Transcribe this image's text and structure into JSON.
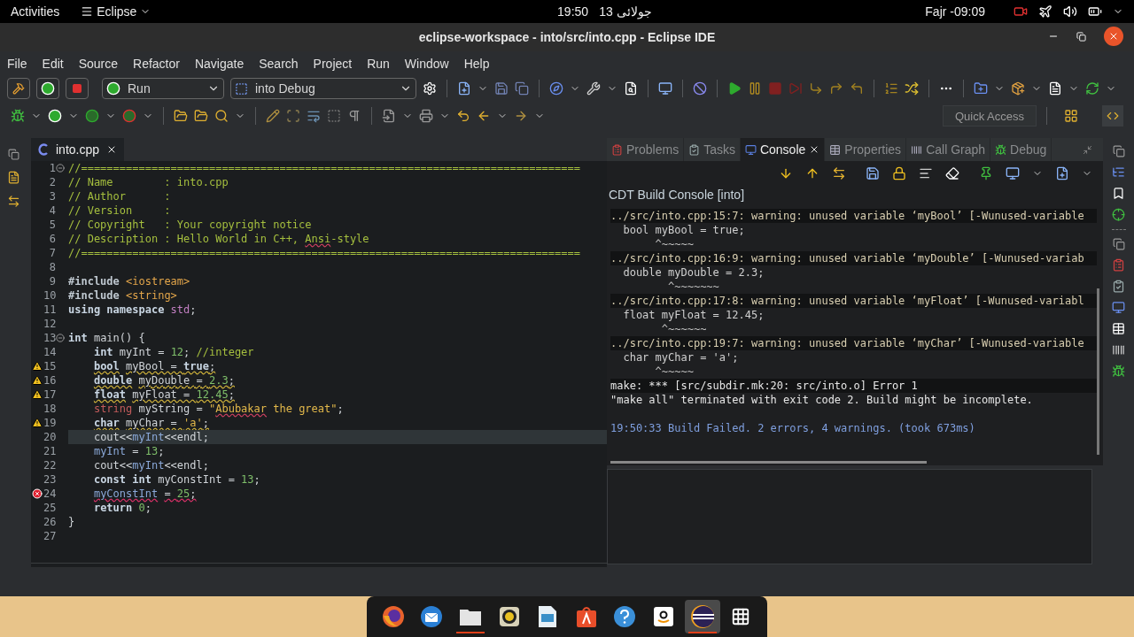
{
  "top_bar": {
    "activities": "Activities",
    "app_menu": "Eclipse",
    "time": "19:50",
    "date": "13 جولائی",
    "prayer": "Fajr -09:09"
  },
  "window": {
    "title": "eclipse-workspace - into/src/into.cpp - Eclipse IDE"
  },
  "menu": [
    "File",
    "Edit",
    "Source",
    "Refactor",
    "Navigate",
    "Search",
    "Project",
    "Run",
    "Window",
    "Help"
  ],
  "toolbar": {
    "run_mode": "Run",
    "launch_config": "into Debug",
    "quick_access": {
      "placeholder": "Quick Access"
    }
  },
  "editor": {
    "tabs": [
      {
        "label": "into.cpp",
        "selected": true
      }
    ],
    "lines": [
      {
        "number": "1",
        "marker": {
          "kind": "fold"
        },
        "highlighted": false,
        "tokens": [
          {
            "text": "//==============================================================================",
            "kind": "comment"
          }
        ]
      },
      {
        "number": "2",
        "highlighted": false,
        "tokens": [
          {
            "text": "// Name        : into.cpp",
            "kind": "comment"
          }
        ]
      },
      {
        "number": "3",
        "highlighted": false,
        "tokens": [
          {
            "text": "// Author      :",
            "kind": "comment"
          }
        ]
      },
      {
        "number": "4",
        "highlighted": false,
        "tokens": [
          {
            "text": "// Version     :",
            "kind": "comment"
          }
        ]
      },
      {
        "number": "5",
        "highlighted": false,
        "tokens": [
          {
            "text": "// Copyright   : Your copyright notice",
            "kind": "comment"
          }
        ]
      },
      {
        "number": "6",
        "highlighted": false,
        "tokens": [
          {
            "text": "// Description : Hello World in C++, ",
            "kind": "comment"
          },
          {
            "text": "Ansi",
            "kind": "comment",
            "squiggle": {
              "kind": "spelling"
            }
          },
          {
            "text": "-style",
            "kind": "comment"
          }
        ]
      },
      {
        "number": "7",
        "highlighted": false,
        "tokens": [
          {
            "text": "//==============================================================================",
            "kind": "comment"
          }
        ]
      },
      {
        "number": "8",
        "highlighted": false
      },
      {
        "number": "9",
        "highlighted": false,
        "tokens": [
          {
            "text": "#include ",
            "kind": "preprocessor"
          },
          {
            "text": "<iostream>",
            "kind": "header"
          }
        ]
      },
      {
        "number": "10",
        "highlighted": false,
        "tokens": [
          {
            "text": "#include ",
            "kind": "preprocessor"
          },
          {
            "text": "<string>",
            "kind": "header"
          }
        ]
      },
      {
        "number": "11",
        "highlighted": false,
        "tokens": [
          {
            "text": "using namespace ",
            "kind": "keyword"
          },
          {
            "text": "std",
            "kind": "namespace"
          },
          {
            "text": ";",
            "kind": "plain"
          }
        ]
      },
      {
        "number": "12",
        "highlighted": false
      },
      {
        "number": "13",
        "marker": {
          "kind": "fold"
        },
        "highlighted": false,
        "tokens": [
          {
            "text": "int",
            "kind": "keyword"
          },
          {
            "text": " main() {",
            "kind": "plain"
          }
        ]
      },
      {
        "number": "14",
        "highlighted": false,
        "tokens": [
          {
            "text": "    int",
            "kind": "keyword"
          },
          {
            "text": " myInt = ",
            "kind": "plain"
          },
          {
            "text": "12",
            "kind": "number"
          },
          {
            "text": "; ",
            "kind": "plain"
          },
          {
            "text": "//integer",
            "kind": "comment"
          }
        ]
      },
      {
        "number": "15",
        "marker": {
          "kind": "warning"
        },
        "highlighted": false,
        "tokens": [
          {
            "text": "    bool",
            "kind": "keyword",
            "squiggle": {
              "kind": "warning"
            }
          },
          {
            "text": " myBool = ",
            "kind": "plain",
            "squiggle": {
              "kind": "warning"
            }
          },
          {
            "text": "true",
            "kind": "keyword",
            "squiggle": {
              "kind": "warning"
            }
          },
          {
            "text": ";",
            "kind": "plain",
            "squiggle": {
              "kind": "warning"
            }
          }
        ]
      },
      {
        "number": "16",
        "marker": {
          "kind": "warning"
        },
        "highlighted": false,
        "tokens": [
          {
            "text": "    double",
            "kind": "keyword",
            "squiggle": {
              "kind": "warning"
            }
          },
          {
            "text": " myDouble = ",
            "kind": "plain",
            "squiggle": {
              "kind": "warning"
            }
          },
          {
            "text": "2.3",
            "kind": "number",
            "squiggle": {
              "kind": "warning"
            }
          },
          {
            "text": ";",
            "kind": "plain",
            "squiggle": {
              "kind": "warning"
            }
          }
        ]
      },
      {
        "number": "17",
        "marker": {
          "kind": "warning"
        },
        "highlighted": false,
        "tokens": [
          {
            "text": "    float",
            "kind": "keyword",
            "squiggle": {
              "kind": "warning"
            }
          },
          {
            "text": " myFloat = ",
            "kind": "plain",
            "squiggle": {
              "kind": "warning"
            }
          },
          {
            "text": "12.45",
            "kind": "number",
            "squiggle": {
              "kind": "warning"
            }
          },
          {
            "text": ";",
            "kind": "plain",
            "squiggle": {
              "kind": "warning"
            }
          }
        ]
      },
      {
        "number": "18",
        "highlighted": false,
        "tokens": [
          {
            "text": "    string",
            "kind": "type"
          },
          {
            "text": " myString = ",
            "kind": "plain"
          },
          {
            "text": "\"",
            "kind": "string"
          },
          {
            "text": "Abubakar",
            "kind": "string",
            "squiggle": {
              "kind": "spelling"
            }
          },
          {
            "text": " the great\"",
            "kind": "string"
          },
          {
            "text": ";",
            "kind": "plain"
          }
        ]
      },
      {
        "number": "19",
        "marker": {
          "kind": "warning"
        },
        "highlighted": false,
        "tokens": [
          {
            "text": "    char",
            "kind": "keyword",
            "squiggle": {
              "kind": "warning"
            }
          },
          {
            "text": " myChar = ",
            "kind": "plain",
            "squiggle": {
              "kind": "warning"
            }
          },
          {
            "text": "'a'",
            "kind": "string",
            "squiggle": {
              "kind": "warning"
            }
          },
          {
            "text": ";",
            "kind": "plain",
            "squiggle": {
              "kind": "warning"
            }
          }
        ]
      },
      {
        "number": "20",
        "highlighted": true,
        "tokens": [
          {
            "text": "    cout<<",
            "kind": "plain"
          },
          {
            "text": "myInt",
            "kind": "variable"
          },
          {
            "text": "<<endl;",
            "kind": "plain"
          }
        ]
      },
      {
        "number": "21",
        "highlighted": false,
        "tokens": [
          {
            "text": "    myInt",
            "kind": "variable"
          },
          {
            "text": " = ",
            "kind": "plain"
          },
          {
            "text": "13",
            "kind": "number"
          },
          {
            "text": ";",
            "kind": "plain"
          }
        ]
      },
      {
        "number": "22",
        "highlighted": false,
        "tokens": [
          {
            "text": "    cout<<",
            "kind": "plain"
          },
          {
            "text": "myInt",
            "kind": "variable"
          },
          {
            "text": "<<endl;",
            "kind": "plain"
          }
        ]
      },
      {
        "number": "23",
        "highlighted": false,
        "tokens": [
          {
            "text": "    const int",
            "kind": "keyword"
          },
          {
            "text": " myConstInt = ",
            "kind": "plain"
          },
          {
            "text": "13",
            "kind": "number"
          },
          {
            "text": ";",
            "kind": "plain"
          }
        ]
      },
      {
        "number": "24",
        "marker": {
          "kind": "error"
        },
        "highlighted": false,
        "tokens": [
          {
            "text": "    myConstInt",
            "kind": "variable",
            "squiggle": {
              "kind": "error"
            }
          },
          {
            "text": " = ",
            "kind": "plain",
            "squiggle": {
              "kind": "error"
            }
          },
          {
            "text": "25",
            "kind": "number",
            "squiggle": {
              "kind": "error"
            }
          },
          {
            "text": ";",
            "kind": "plain",
            "squiggle": {
              "kind": "error"
            }
          }
        ]
      },
      {
        "number": "25",
        "highlighted": false,
        "tokens": [
          {
            "text": "    return ",
            "kind": "keyword"
          },
          {
            "text": "0",
            "kind": "number"
          },
          {
            "text": ";",
            "kind": "plain"
          }
        ]
      },
      {
        "number": "26",
        "highlighted": false,
        "tokens": [
          {
            "text": "}",
            "kind": "plain"
          }
        ]
      },
      {
        "number": "27",
        "highlighted": false
      }
    ]
  },
  "views": {
    "tabs": [
      {
        "label": "Problems",
        "kind": "problems",
        "selected": false
      },
      {
        "label": "Tasks",
        "kind": "tasks",
        "selected": false
      },
      {
        "label": "Console",
        "kind": "console",
        "selected": true
      },
      {
        "label": "Properties",
        "kind": "properties",
        "selected": false
      },
      {
        "label": "Call Graph",
        "kind": "callgraph",
        "selected": false
      },
      {
        "label": "Debug",
        "kind": "debug",
        "selected": false
      }
    ],
    "console_title": "CDT Build Console [into]",
    "console": [
      {
        "kind": "diagnostic",
        "text": "../src/into.cpp:15:7: warning: unused variable ‘myBool’ [-Wunused-variable"
      },
      {
        "kind": "source",
        "text": "  bool myBool = true;"
      },
      {
        "kind": "caret",
        "text": "       ^~~~~~"
      },
      {
        "kind": "diagnostic",
        "text": "../src/into.cpp:16:9: warning: unused variable ‘myDouble’ [-Wunused-variab"
      },
      {
        "kind": "source",
        "text": "  double myDouble = 2.3;"
      },
      {
        "kind": "caret",
        "text": "         ^~~~~~~~"
      },
      {
        "kind": "diagnostic",
        "text": "../src/into.cpp:17:8: warning: unused variable ‘myFloat’ [-Wunused-variabl"
      },
      {
        "kind": "source",
        "text": "  float myFloat = 12.45;"
      },
      {
        "kind": "caret",
        "text": "        ^~~~~~~"
      },
      {
        "kind": "diagnostic",
        "text": "../src/into.cpp:19:7: warning: unused variable ‘myChar’ [-Wunused-variable"
      },
      {
        "kind": "source",
        "text": "  char myChar = 'a';"
      },
      {
        "kind": "caret",
        "text": "       ^~~~~~"
      },
      {
        "kind": "error",
        "text": "make: *** [src/subdir.mk:20: src/into.o] Error 1"
      },
      {
        "kind": "message",
        "text": "\"make all\" terminated with exit code 2. Build might be incomplete."
      },
      {
        "kind": "summary",
        "text": "19:50:33 Build Failed. 2 errors, 4 warnings. (took 673ms)"
      }
    ]
  },
  "dock": [
    {
      "kind": "browser",
      "running": false,
      "selected": false
    },
    {
      "kind": "mail",
      "running": false,
      "selected": false
    },
    {
      "kind": "files",
      "running": true,
      "selected": false
    },
    {
      "kind": "music",
      "running": false,
      "selected": false
    },
    {
      "kind": "presentation",
      "running": false,
      "selected": false
    },
    {
      "kind": "store",
      "running": false,
      "selected": false
    },
    {
      "kind": "help",
      "running": false,
      "selected": false
    },
    {
      "kind": "shop",
      "running": false,
      "selected": false
    },
    {
      "kind": "ide",
      "running": true,
      "selected": true
    },
    {
      "kind": "apps",
      "running": false,
      "selected": false
    }
  ]
}
